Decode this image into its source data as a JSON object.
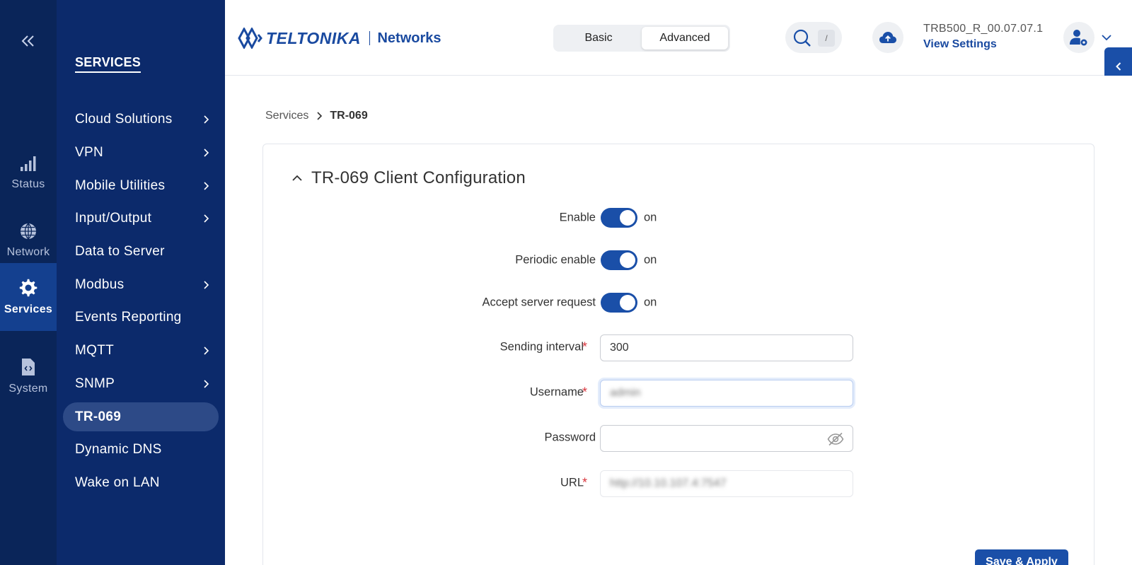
{
  "rail": {
    "items": [
      {
        "label": "Status",
        "icon": "signal-bars-icon"
      },
      {
        "label": "Network",
        "icon": "globe-icon"
      },
      {
        "label": "Services",
        "icon": "gear-icon"
      },
      {
        "label": "System",
        "icon": "system-file-icon"
      }
    ],
    "active": "Services"
  },
  "sidebar": {
    "title": "SERVICES",
    "items": [
      {
        "label": "Cloud Solutions",
        "has_submenu": true
      },
      {
        "label": "VPN",
        "has_submenu": true
      },
      {
        "label": "Mobile Utilities",
        "has_submenu": true
      },
      {
        "label": "Input/Output",
        "has_submenu": true
      },
      {
        "label": "Data to Server",
        "has_submenu": false
      },
      {
        "label": "Modbus",
        "has_submenu": true
      },
      {
        "label": "Events Reporting",
        "has_submenu": false
      },
      {
        "label": "MQTT",
        "has_submenu": true
      },
      {
        "label": "SNMP",
        "has_submenu": true
      },
      {
        "label": "TR-069",
        "has_submenu": false
      },
      {
        "label": "Dynamic DNS",
        "has_submenu": false
      },
      {
        "label": "Wake on LAN",
        "has_submenu": false
      }
    ],
    "active": "TR-069"
  },
  "header": {
    "logo_word": "TELTONIKA",
    "logo_networks": "Networks",
    "mode_basic": "Basic",
    "mode_advanced": "Advanced",
    "mode_selected": "Advanced",
    "search_shortcut": "/",
    "firmware_version": "TRB500_R_00.07.07.1",
    "view_settings": "View Settings"
  },
  "breadcrumb": {
    "parent": "Services",
    "current": "TR-069"
  },
  "card": {
    "title": "TR-069 Client Configuration",
    "fields": {
      "enable": {
        "label": "Enable",
        "state": "on"
      },
      "periodic_enable": {
        "label": "Periodic enable",
        "state": "on"
      },
      "accept_server_request": {
        "label": "Accept server request",
        "state": "on"
      },
      "sending_interval": {
        "label": "Sending interval",
        "value": "300",
        "required": true
      },
      "username": {
        "label": "Username",
        "value": "admin",
        "required": true
      },
      "password": {
        "label": "Password",
        "value": "",
        "required": false
      },
      "url": {
        "label": "URL",
        "value": "http://10.10.107.4:7547",
        "required": true
      }
    },
    "save_label": "Save & Apply"
  },
  "colors": {
    "rail_bg": "#0a2559",
    "sidebar_bg": "#0c2a6b",
    "accent": "#1a4fa8",
    "required": "#d9363e"
  }
}
